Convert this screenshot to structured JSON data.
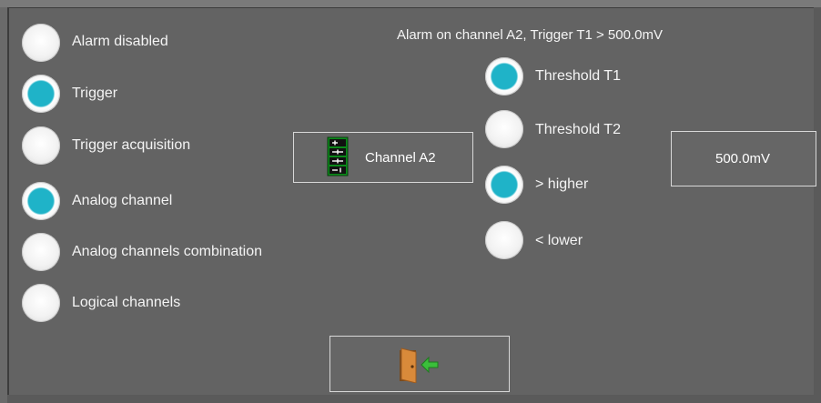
{
  "status_text": "Alarm on channel A2, Trigger T1 >  500.0mV",
  "alarm_modes": [
    {
      "label": "Alarm disabled",
      "selected": false
    },
    {
      "label": "Trigger",
      "selected": true
    },
    {
      "label": "Trigger acquisition",
      "selected": false
    },
    {
      "label": "Analog channel",
      "selected": true
    },
    {
      "label": "Analog channels combination",
      "selected": false
    },
    {
      "label": "Logical channels",
      "selected": false
    }
  ],
  "channel_button": {
    "label": "Channel A2",
    "icon": "channel-icon"
  },
  "threshold_options": [
    {
      "label": "Threshold T1",
      "selected": true
    },
    {
      "label": "Threshold T2",
      "selected": false
    }
  ],
  "direction_options": [
    {
      "label": "> higher",
      "selected": true
    },
    {
      "label": "< lower",
      "selected": false
    }
  ],
  "value_button": {
    "label": "500.0mV"
  },
  "exit_button": {
    "icon": "exit-door-icon"
  },
  "colors": {
    "selected_radio": "#1fb3c8",
    "background": "#636363",
    "button_border": "#d8d8d8"
  }
}
